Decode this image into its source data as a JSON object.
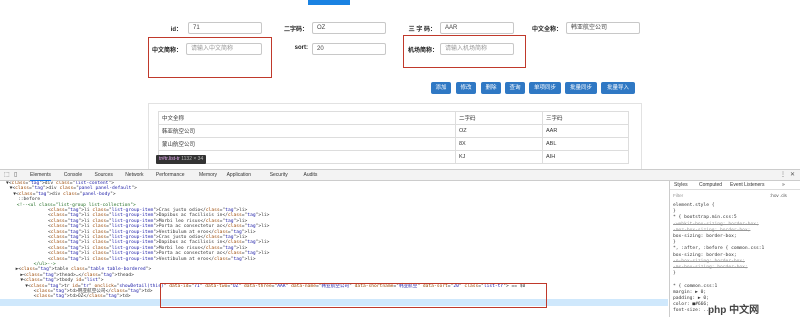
{
  "form": {
    "id_label": "id：",
    "id_value": "71",
    "two_char_label": "二字码：",
    "two_char_value": "OZ",
    "three_char_label": "三 字 码：",
    "three_char_value": "AAR",
    "cn_name_label": "中文全称：",
    "cn_name_value": "韩亚航空公司",
    "cn_short_label": "中文简称：",
    "cn_short_placeholder": "请输入中文简称",
    "sort_label": "sort:",
    "sort_value": "20",
    "airport_short_label": "机场简称：",
    "airport_short_placeholder": "请输入机场简称"
  },
  "buttons": [
    "添加",
    "修改",
    "删除",
    "查询",
    "单项同步",
    "批量同步",
    "批量导入"
  ],
  "table": {
    "headers": [
      "中文全称",
      "二字码",
      "三字码"
    ],
    "rows": [
      [
        "韩亚航空公司",
        "OZ",
        "AAR"
      ],
      [
        "蒙山航空公司",
        "8X",
        "ABL"
      ],
      [
        "",
        "KJ",
        "AIH"
      ]
    ]
  },
  "tooltip": {
    "selector": "tr#tr.list-tr",
    "size": "1132 × 34"
  },
  "devtools": {
    "tabs": [
      "Elements",
      "Console",
      "Sources",
      "Network",
      "Performance",
      "Memory",
      "Application",
      "Security",
      "Audits"
    ],
    "right_tabs": [
      "Styles",
      "Computed",
      "Event Listeners",
      "»"
    ],
    "filter": "Filter",
    "hov_cls": ":hov .cls",
    "dom_lines": [
      {
        "i": 5,
        "h": "▼<div class=\"list-content\">"
      },
      {
        "i": 8,
        "h": "▼<div class=\"panel panel-default\">"
      },
      {
        "i": 11,
        "h": "▼<div class=\"panel-body\">"
      },
      {
        "i": 15,
        "h": "::before"
      },
      {
        "i": 14,
        "h": "<!--<ul class=\"list-group list-collection\">"
      },
      {
        "i": 40,
        "h": "<li class=\"list-group-item\">Cras justo odio</li>"
      },
      {
        "i": 40,
        "h": "<li class=\"list-group-item\">Dapibus ac facilisis in</li>"
      },
      {
        "i": 40,
        "h": "<li class=\"list-group-item\">Morbi leo risus</li>"
      },
      {
        "i": 40,
        "h": "<li class=\"list-group-item\">Porta ac consectetur ac</li>"
      },
      {
        "i": 40,
        "h": "<li class=\"list-group-item\">Vestibulum at eros</li>"
      },
      {
        "i": 40,
        "h": "<li class=\"list-group-item\">Cras justo odio</li>"
      },
      {
        "i": 40,
        "h": "<li class=\"list-group-item\">Dapibus ac facilisis in</li>"
      },
      {
        "i": 40,
        "h": "<li class=\"list-group-item\">Morbi leo risus</li>"
      },
      {
        "i": 40,
        "h": "<li class=\"list-group-item\">Porta ac consectetur ac</li>"
      },
      {
        "i": 40,
        "h": "<li class=\"list-group-item\">Vestibulum at eros</li>"
      },
      {
        "i": 28,
        "h": "</ul>-->"
      },
      {
        "i": 13,
        "h": "▶<table class=\"table table-bordered\">"
      },
      {
        "i": 17,
        "h": "▶<thead>…</thead>"
      },
      {
        "i": 17,
        "h": "▼<tbody id=\"list\">"
      },
      {
        "i": 21,
        "h": "▼<tr id=\"tr\" onclick=\"showDetail(this)\" data-id=\"71\" data-two=\"OZ\" data-three=\"AAR\" data-name=\"韩亚航空公司\" data-shortname=\"韩亚航空\" data-sort=\"20\" class=\"list-tr\"> == $0"
      },
      {
        "i": 28,
        "h": "<td>韩亚航空公司</td>"
      },
      {
        "i": 28,
        "h": "<td>OZ</td>"
      }
    ],
    "styles_lines": [
      "element.style {",
      "}",
      "* {                        bootstrap.min.css:5",
      "  -webkit-box-sizing: border-box;",
      "  -moz-box-sizing: border-box;",
      "  box-sizing: border-box;",
      "}",
      "*, :after, :before {          common.css:1",
      "  box-sizing: border-box;",
      "  -o-box-sizing: border-box;",
      "  -ms-box-sizing: border-box;",
      "}",
      "",
      "* {                            common.css:1",
      "  margin: ▶ 0;",
      "  padding: ▶ 0;",
      "  color: ■#666;",
      "  font-size: ..."
    ]
  },
  "watermark": "php 中文网",
  "colors": {
    "accent": "#1a82e2",
    "button": "#2f78c4",
    "highlight_red": "#c0392b"
  }
}
